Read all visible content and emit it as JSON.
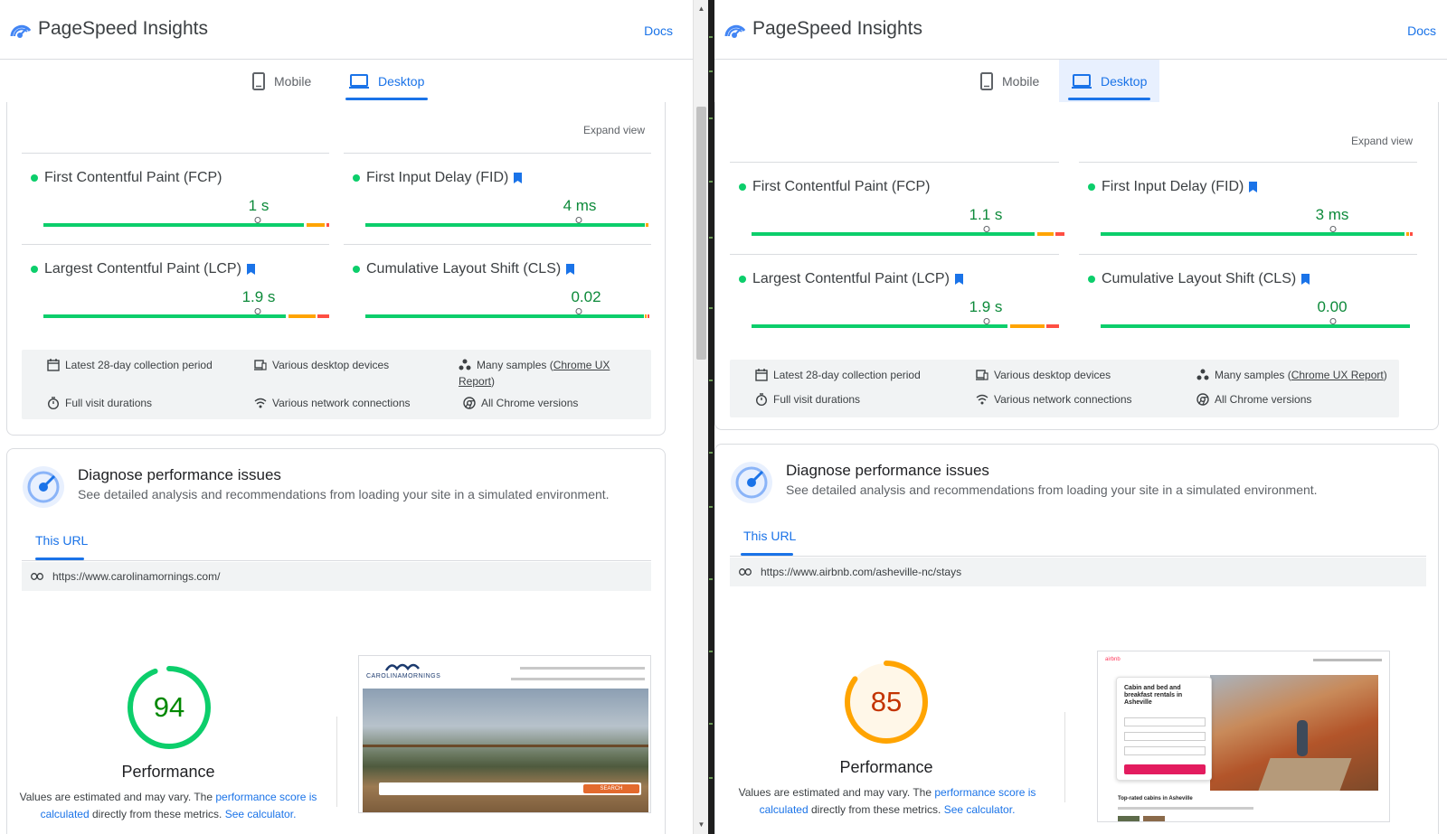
{
  "app": {
    "title": "PageSpeed Insights",
    "docs_label": "Docs"
  },
  "tabs": {
    "mobile": "Mobile",
    "desktop": "Desktop"
  },
  "left": {
    "expand_view": "Expand view",
    "metrics": {
      "fcp": {
        "name": "First Contentful Paint (FCP)",
        "value": "1 s",
        "flag": false
      },
      "fid": {
        "name": "First Input Delay (FID)",
        "value": "4 ms",
        "flag": true
      },
      "lcp": {
        "name": "Largest Contentful Paint (LCP)",
        "value": "1.9 s",
        "flag": true
      },
      "cls": {
        "name": "Cumulative Layout Shift (CLS)",
        "value": "0.02",
        "flag": true
      }
    },
    "info": {
      "period": "Latest 28-day collection period",
      "devices": "Various desktop devices",
      "samples_prefix": "Many samples (",
      "samples_link_1": "Chrome UX",
      "samples_link_2": "Report",
      "samples_suffix": ")",
      "durations": "Full visit durations",
      "network": "Various network connections",
      "versions": "All Chrome versions"
    },
    "diagnose": {
      "title": "Diagnose performance issues",
      "subtitle": "See detailed analysis and recommendations from loading your site in a simulated environment.",
      "tab": "This URL",
      "url": "https://www.carolinamornings.com/"
    },
    "performance": {
      "score": "94",
      "score_fraction": 0.94,
      "label": "Performance",
      "note_1": "Values are estimated and may vary. The ",
      "note_link_1": "performance score is",
      "note_link_2": "calculated",
      "note_2": " directly from these metrics. ",
      "note_link_3": "See calculator."
    }
  },
  "right": {
    "expand_view": "Expand view",
    "metrics": {
      "fcp": {
        "name": "First Contentful Paint (FCP)",
        "value": "1.1 s",
        "flag": false
      },
      "fid": {
        "name": "First Input Delay (FID)",
        "value": "3 ms",
        "flag": true
      },
      "lcp": {
        "name": "Largest Contentful Paint (LCP)",
        "value": "1.9 s",
        "flag": true
      },
      "cls": {
        "name": "Cumulative Layout Shift (CLS)",
        "value": "0.00",
        "flag": true
      }
    },
    "info": {
      "period": "Latest 28-day collection period",
      "devices": "Various desktop devices",
      "samples_prefix": "Many samples (",
      "samples_link": "Chrome UX Report",
      "samples_suffix": ")",
      "durations": "Full visit durations",
      "network": "Various network connections",
      "versions": "All Chrome versions"
    },
    "diagnose": {
      "title": "Diagnose performance issues",
      "subtitle": "See detailed analysis and recommendations from loading your site in a simulated environment.",
      "tab": "This URL",
      "url": "https://www.airbnb.com/asheville-nc/stays"
    },
    "performance": {
      "score": "85",
      "score_fraction": 0.85,
      "label": "Performance",
      "note_1": "Values are estimated and may vary. The ",
      "note_link_1": "performance score is",
      "note_link_2": "calculated",
      "note_2": " directly from these metrics. ",
      "note_link_3": "See calculator."
    }
  },
  "thumbnails": {
    "left": {
      "brand": "CAROLINAMORNINGS",
      "search_button": "SEARCH"
    },
    "right": {
      "brand": "airbnb",
      "headline": "Cabin and bed and breakfast rentals in Asheville",
      "caption": "Top-rated cabins in Asheville"
    }
  },
  "colors": {
    "accent": "#1a73e8",
    "good": "#0cce6b",
    "average": "#ffa400",
    "poor": "#ff4e42",
    "score_good_text": "#008800",
    "score_avg_text": "#c33300"
  }
}
